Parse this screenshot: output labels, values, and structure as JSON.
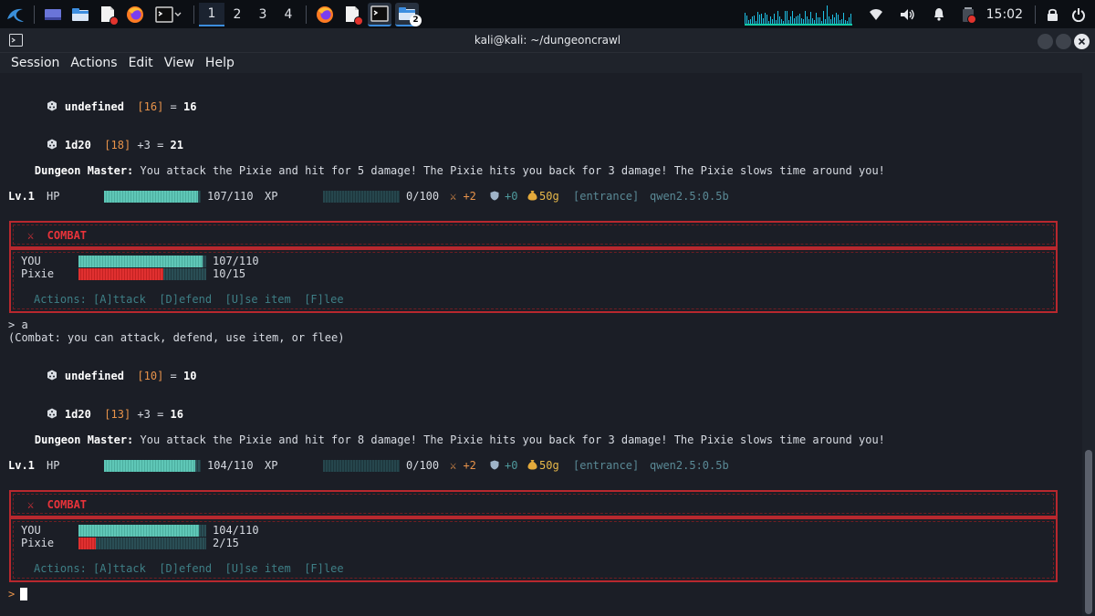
{
  "taskbar": {
    "workspaces": [
      "1",
      "2",
      "3",
      "4"
    ],
    "folder_badge": "2",
    "clock": "15:02",
    "colors": {
      "accent": "#3c8ddd",
      "tray_graph": "#1ec1e6"
    }
  },
  "window": {
    "title": "kali@kali: ~/dungeoncrawl",
    "menu": [
      "Session",
      "Actions",
      "Edit",
      "View",
      "Help"
    ]
  },
  "terminal": {
    "roll1": {
      "name": "undefined",
      "bracket": "[16]",
      "rest": " = ",
      "total": "16"
    },
    "roll2": {
      "name": "1d20",
      "bracket": "[18]",
      "rest": " +3 = ",
      "total": "21"
    },
    "dm1": {
      "label": "Dungeon Master:",
      "text": " You attack the Pixie and hit for 5 damage! The Pixie hits you back for 3 damage! The Pixie slows time around you!"
    },
    "status1": {
      "level": "Lv.1",
      "hp_label": "HP",
      "hp": "107/110",
      "hp_ratio": 0.973,
      "xp_label": "XP",
      "xp": "0/100",
      "xp_ratio": 0,
      "atk": "⚔ +2",
      "def": "+0",
      "gold": "50g",
      "location": "[entrance]",
      "model": "qwen2.5:0.5b"
    },
    "combat1": {
      "title": "⚔  COMBAT",
      "you_label": "YOU",
      "you_hp": "107/110",
      "you_ratio": 0.973,
      "enemy_label": "Pixie",
      "enemy_hp": "10/15",
      "enemy_ratio": 0.667,
      "actions": "Actions: [A]ttack  [D]efend  [U]se item  [F]lee"
    },
    "input_line": "> a",
    "hint": "(Combat: you can attack, defend, use item, or flee)",
    "roll3": {
      "name": "undefined",
      "bracket": "[10]",
      "rest": " = ",
      "total": "10"
    },
    "roll4": {
      "name": "1d20",
      "bracket": "[13]",
      "rest": " +3 = ",
      "total": "16"
    },
    "dm2": {
      "label": "Dungeon Master:",
      "text": " You attack the Pixie and hit for 8 damage! The Pixie hits you back for 3 damage! The Pixie slows time around you!"
    },
    "status2": {
      "level": "Lv.1",
      "hp_label": "HP",
      "hp": "104/110",
      "hp_ratio": 0.945,
      "xp_label": "XP",
      "xp": "0/100",
      "xp_ratio": 0,
      "atk": "⚔ +2",
      "def": "+0",
      "gold": "50g",
      "location": "[entrance]",
      "model": "qwen2.5:0.5b"
    },
    "combat2": {
      "title": "⚔  COMBAT",
      "you_label": "YOU",
      "you_hp": "104/110",
      "you_ratio": 0.945,
      "enemy_label": "Pixie",
      "enemy_hp": "2/15",
      "enemy_ratio": 0.133,
      "actions": "Actions: [A]ttack  [D]efend  [U]se item  [F]lee"
    },
    "prompt": ">"
  }
}
